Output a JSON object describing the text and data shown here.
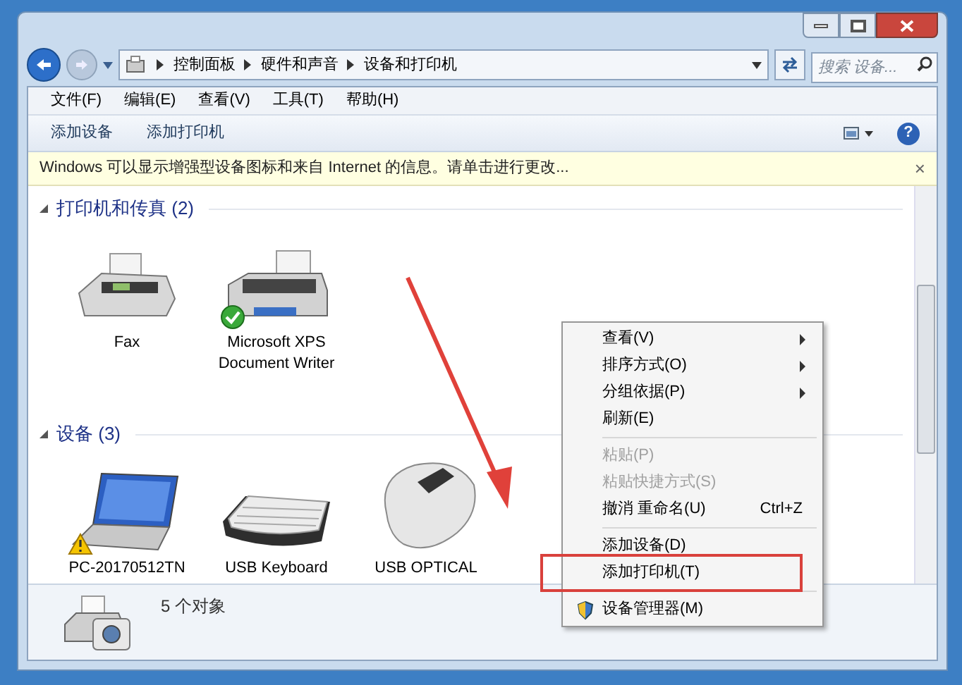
{
  "address": {
    "breadcrumb": [
      "控制面板",
      "硬件和声音",
      "设备和打印机"
    ],
    "search_placeholder": "搜索 设备..."
  },
  "menu_bar": [
    "文件(F)",
    "编辑(E)",
    "查看(V)",
    "工具(T)",
    "帮助(H)"
  ],
  "toolbar": [
    "添加设备",
    "添加打印机"
  ],
  "help_button": "?",
  "info_bar": {
    "text": "Windows 可以显示增强型设备图标和来自 Internet 的信息。请单击进行更改...",
    "close": "×"
  },
  "groups": [
    {
      "title": "打印机和传真 (2)",
      "expanded": true,
      "items": [
        {
          "name": "Fax",
          "kind": "fax",
          "is_default": false,
          "warning": false
        },
        {
          "name": "Microsoft XPS Document Writer",
          "kind": "printer",
          "is_default": true,
          "warning": false
        }
      ]
    },
    {
      "title": "设备 (3)",
      "expanded": true,
      "items": [
        {
          "name": "PC-20170512TN",
          "kind": "laptop",
          "is_default": false,
          "warning": true
        },
        {
          "name": "USB Keyboard",
          "kind": "keyboard",
          "is_default": false,
          "warning": false
        },
        {
          "name": "USB OPTICAL",
          "kind": "mouse",
          "is_default": false,
          "warning": false
        }
      ]
    }
  ],
  "status_bar": {
    "text": "5 个对象"
  },
  "context_menu": [
    {
      "kind": "command",
      "label": "查看(V)",
      "submenu": true,
      "disabled": false,
      "highlighted": false
    },
    {
      "kind": "command",
      "label": "排序方式(O)",
      "submenu": true,
      "disabled": false,
      "highlighted": false
    },
    {
      "kind": "command",
      "label": "分组依据(P)",
      "submenu": true,
      "disabled": false,
      "highlighted": false
    },
    {
      "kind": "command",
      "label": "刷新(E)",
      "submenu": false,
      "disabled": false,
      "highlighted": false
    },
    {
      "kind": "separator"
    },
    {
      "kind": "command",
      "label": "粘贴(P)",
      "submenu": false,
      "disabled": true,
      "highlighted": false
    },
    {
      "kind": "command",
      "label": "粘贴快捷方式(S)",
      "submenu": false,
      "disabled": true,
      "highlighted": false
    },
    {
      "kind": "command",
      "label": "撤消 重命名(U)",
      "shortcut": "Ctrl+Z",
      "submenu": false,
      "disabled": false,
      "highlighted": false
    },
    {
      "kind": "separator"
    },
    {
      "kind": "command",
      "label": "添加设备(D)",
      "submenu": false,
      "disabled": false,
      "highlighted": false
    },
    {
      "kind": "command",
      "label": "添加打印机(T)",
      "submenu": false,
      "disabled": false,
      "highlighted": true
    },
    {
      "kind": "separator"
    },
    {
      "kind": "admin",
      "label": "设备管理器(M)",
      "submenu": false,
      "disabled": false,
      "highlighted": false
    }
  ]
}
